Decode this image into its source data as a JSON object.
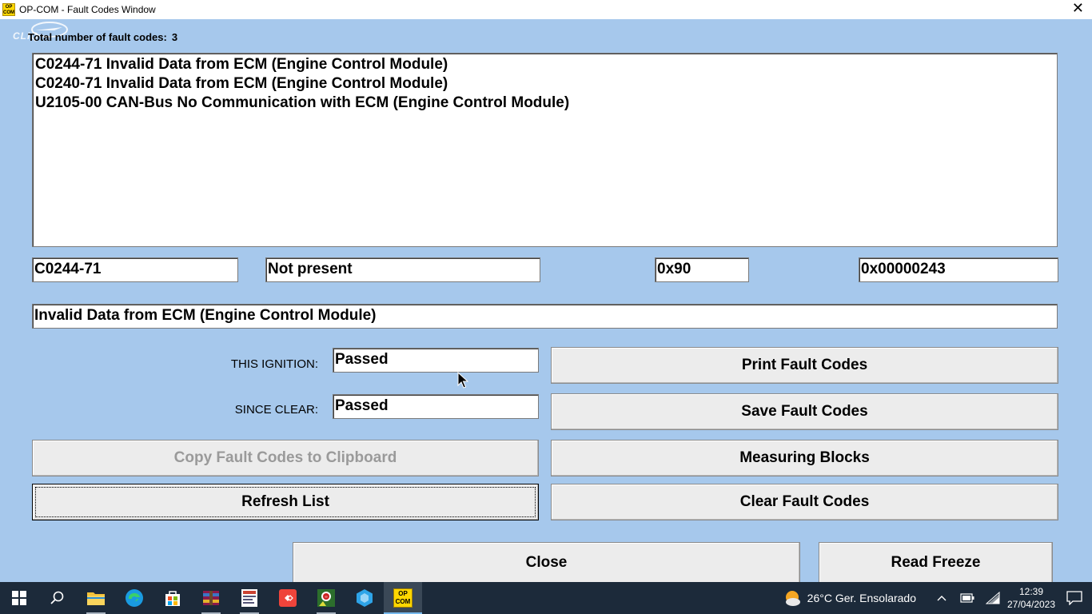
{
  "window": {
    "title": "OP-COM - Fault Codes Window",
    "icon_text_top": "OP",
    "icon_text_bottom": "COM"
  },
  "logo": {
    "text": "CLIQ"
  },
  "summary": {
    "total_label": "Total number of fault codes:",
    "total_value": "3"
  },
  "fault_list": [
    "C0244-71 Invalid Data from ECM (Engine Control Module)",
    "C0240-71 Invalid Data from ECM (Engine Control Module)",
    "U2105-00 CAN-Bus No Communication with ECM (Engine Control Module)"
  ],
  "detail": {
    "code": "C0244-71",
    "status": "Not present",
    "byte_value": "0x90",
    "hex_value": "0x00000243",
    "description": "Invalid Data from ECM (Engine Control Module)"
  },
  "tests": {
    "this_ignition_label": "THIS IGNITION:",
    "this_ignition_value": "Passed",
    "since_clear_label": "SINCE CLEAR:",
    "since_clear_value": "Passed"
  },
  "buttons": {
    "print": "Print Fault Codes",
    "save": "Save Fault Codes",
    "copy": "Copy Fault Codes to Clipboard",
    "measuring": "Measuring Blocks",
    "refresh": "Refresh List",
    "clear": "Clear Fault Codes",
    "close": "Close",
    "read_freeze": "Read Freeze"
  },
  "taskbar": {
    "apps": [
      "start-icon",
      "search-icon",
      "file-explorer-icon",
      "edge-icon",
      "store-icon",
      "winrar-icon",
      "document-app-icon",
      "anydesk-icon",
      "car-diagnostic-icon",
      "3d-app-icon",
      "op-com-icon"
    ],
    "opcom_label_top": "OP",
    "opcom_label_bottom": "COM",
    "weather": "26°C  Ger. Ensolarado",
    "time": "12:39",
    "date": "27/04/2023"
  },
  "colors": {
    "window_bg": "#a6c8ec",
    "taskbar_bg": "#1c2a3a",
    "button_bg": "#ececec",
    "disabled_text": "#9a9a9a"
  }
}
